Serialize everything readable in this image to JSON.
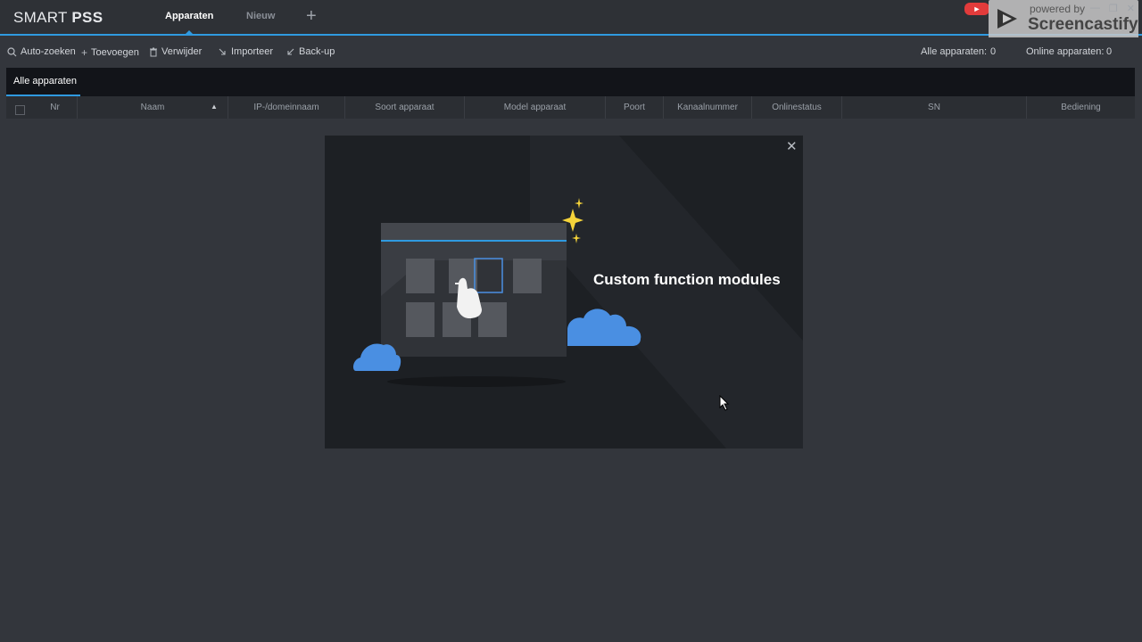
{
  "app": {
    "logo_prefix": "SMART ",
    "logo_bold": "PSS",
    "tabs": [
      {
        "label": "Apparaten",
        "active": true
      },
      {
        "label": "Nieuw",
        "active": false
      }
    ],
    "add_tab_icon": "plus-icon"
  },
  "window_controls": [
    "—",
    "❐",
    "✕"
  ],
  "watermark": {
    "small": "powered by",
    "big": "Screencastify"
  },
  "toolbar": {
    "buttons": [
      {
        "label": "Auto-zoeken",
        "icon": "search-icon"
      },
      {
        "label": "Toevoegen",
        "icon": "plus-icon"
      },
      {
        "label": "Verwijder",
        "icon": "trash-icon"
      },
      {
        "label": "Importeer",
        "icon": "import-icon"
      },
      {
        "label": "Back-up",
        "icon": "backup-icon"
      }
    ],
    "all_devices_label": "Alle apparaten:",
    "all_devices_count": "0",
    "online_devices_label": "Online apparaten:",
    "online_devices_count": "0"
  },
  "device_tabs": [
    {
      "label": "Alle apparaten",
      "active": true
    }
  ],
  "table": {
    "columns": [
      "Nr",
      "Naam",
      "IP-/domeinnaam",
      "Soort apparaat",
      "Model apparaat",
      "Poort",
      "Kanaalnummer",
      "Onlinestatus",
      "SN",
      "Bediening"
    ],
    "rows": []
  },
  "modal": {
    "title": "Custom function modules",
    "close_icon": "close-icon"
  },
  "colors": {
    "accent": "#2f9ae0",
    "background": "#33363c",
    "modal_bg": "#1d2024",
    "cloud": "#4a8fe2",
    "sparkle": "#f5d33a"
  }
}
